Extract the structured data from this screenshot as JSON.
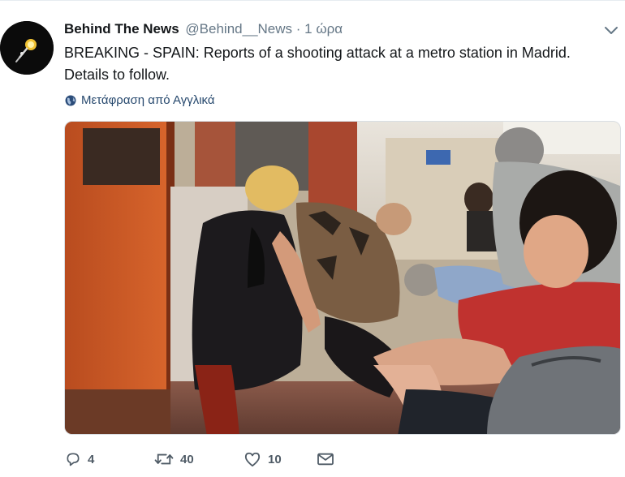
{
  "author": {
    "name": "Behind The News",
    "handle": "@Behind__News",
    "separator": "·",
    "time": "1 ώρα",
    "avatar_icon": "lightbulb-icon"
  },
  "tweet": {
    "text": "BREAKING - SPAIN: Reports of a shooting attack at a metro station in Madrid. Details to follow."
  },
  "translate": {
    "icon": "globe-icon",
    "label": "Μετάφραση από Αγγλικά"
  },
  "media": {
    "type": "photo"
  },
  "actions": {
    "reply": {
      "icon": "reply-icon",
      "count": "4"
    },
    "retweet": {
      "icon": "retweet-icon",
      "count": "40"
    },
    "like": {
      "icon": "heart-icon",
      "count": "10"
    },
    "dm": {
      "icon": "envelope-icon"
    }
  },
  "colors": {
    "text": "#14171a",
    "secondary": "#657786",
    "link": "#1b3d6b"
  }
}
